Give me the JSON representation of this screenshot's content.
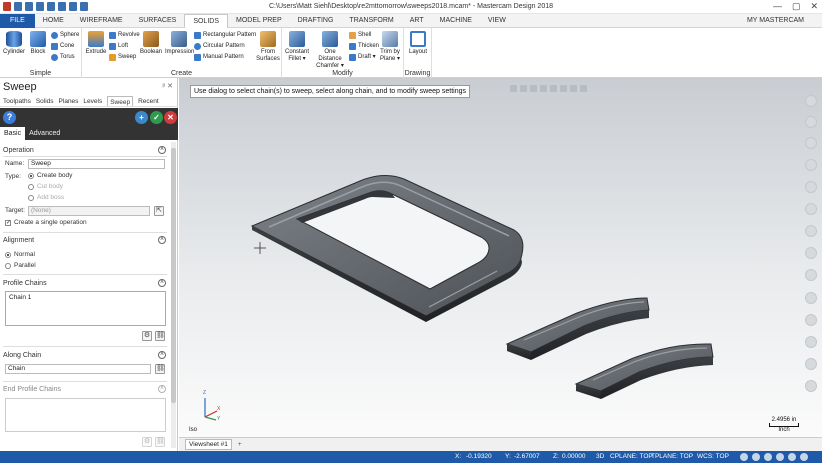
{
  "titlebar": {
    "title": "C:\\Users\\Matt Siehl\\Desktop\\re2mttomorrow\\sweeps2018.mcam* - Mastercam Design 2018",
    "controls": [
      "—",
      "▢",
      "✕"
    ]
  },
  "tabs": [
    "FILE",
    "HOME",
    "WIREFRAME",
    "SURFACES",
    "SOLIDS",
    "MODEL PREP",
    "DRAFTING",
    "TRANSFORM",
    "ART",
    "MACHINE",
    "VIEW"
  ],
  "my_mastercam": "MY MASTERCAM",
  "ribbon": {
    "simple": {
      "label": "Simple",
      "cylinder": "Cylinder",
      "block": "Block",
      "sphere": "Sphere",
      "cone": "Cone",
      "torus": "Torus"
    },
    "create": {
      "label": "Create",
      "extrude": "Extrude",
      "revolve": "Revolve",
      "loft": "Loft",
      "sweep": "Sweep",
      "boolean": "Boolean",
      "impression": "Impression",
      "rect_pattern": "Rectangular Pattern",
      "circ_pattern": "Circular Pattern",
      "manual_pattern": "Manual Pattern",
      "from_surfaces": "From Surfaces"
    },
    "modify": {
      "label": "Modify",
      "constant_fillet": "Constant Fillet ▾",
      "one_distance_chamfer": "One Distance Chamfer ▾",
      "shell": "Shell",
      "thicken": "Thicken",
      "draft": "Draft ▾",
      "trim_by_plane": "Trim by Plane ▾"
    },
    "drawing": {
      "label": "Drawing",
      "layout": "Layout"
    }
  },
  "panel": {
    "title": "Sweep",
    "pin": "ᵖ ✕",
    "manager_tabs": [
      "Toolpaths",
      "Solids",
      "Planes",
      "Levels",
      "Sweep",
      "Recent Functions"
    ],
    "help": "?",
    "subtabs": [
      "Basic",
      "Advanced"
    ],
    "operation": {
      "heading": "Operation",
      "name_label": "Name:",
      "name_value": "Sweep",
      "type_label": "Type:",
      "create_body": "Create body",
      "cut_body": "Cut body",
      "add_boss": "Add boss",
      "target_label": "Target:",
      "target_value": "(None)",
      "single_op": "Create a single operation"
    },
    "alignment": {
      "heading": "Alignment",
      "normal": "Normal",
      "parallel": "Parallel"
    },
    "profile": {
      "heading": "Profile Chains",
      "chain": "Chain  1"
    },
    "along": {
      "heading": "Along Chain",
      "chain": "Chain"
    },
    "end_profile": {
      "heading": "End Profile Chains"
    }
  },
  "viewport": {
    "prompt": "Use dialog to select chain(s) to sweep, select along chain, and to modify sweep settings",
    "scale_value": "2.4956 in",
    "scale_unit": "Inch",
    "iso": "Iso",
    "triad": {
      "x": "X",
      "y": "Y",
      "z": "Z"
    }
  },
  "viewsheet": {
    "tab": "Viewsheet #1",
    "add": "+"
  },
  "status": {
    "x_label": "X:",
    "x": "-0.19320",
    "y_label": "Y:",
    "y": "-2.67007",
    "z_label": "Z:",
    "z": "0.00000",
    "mode": "3D",
    "cplane": "CPLANE: TOP",
    "tplane": "TPLANE: TOP",
    "wcs": "WCS: TOP"
  },
  "colors": {
    "accent": "#1e5aa8",
    "confirm": "#2e9b4e",
    "cancel": "#d23b3b",
    "apply": "#3c88c8"
  }
}
